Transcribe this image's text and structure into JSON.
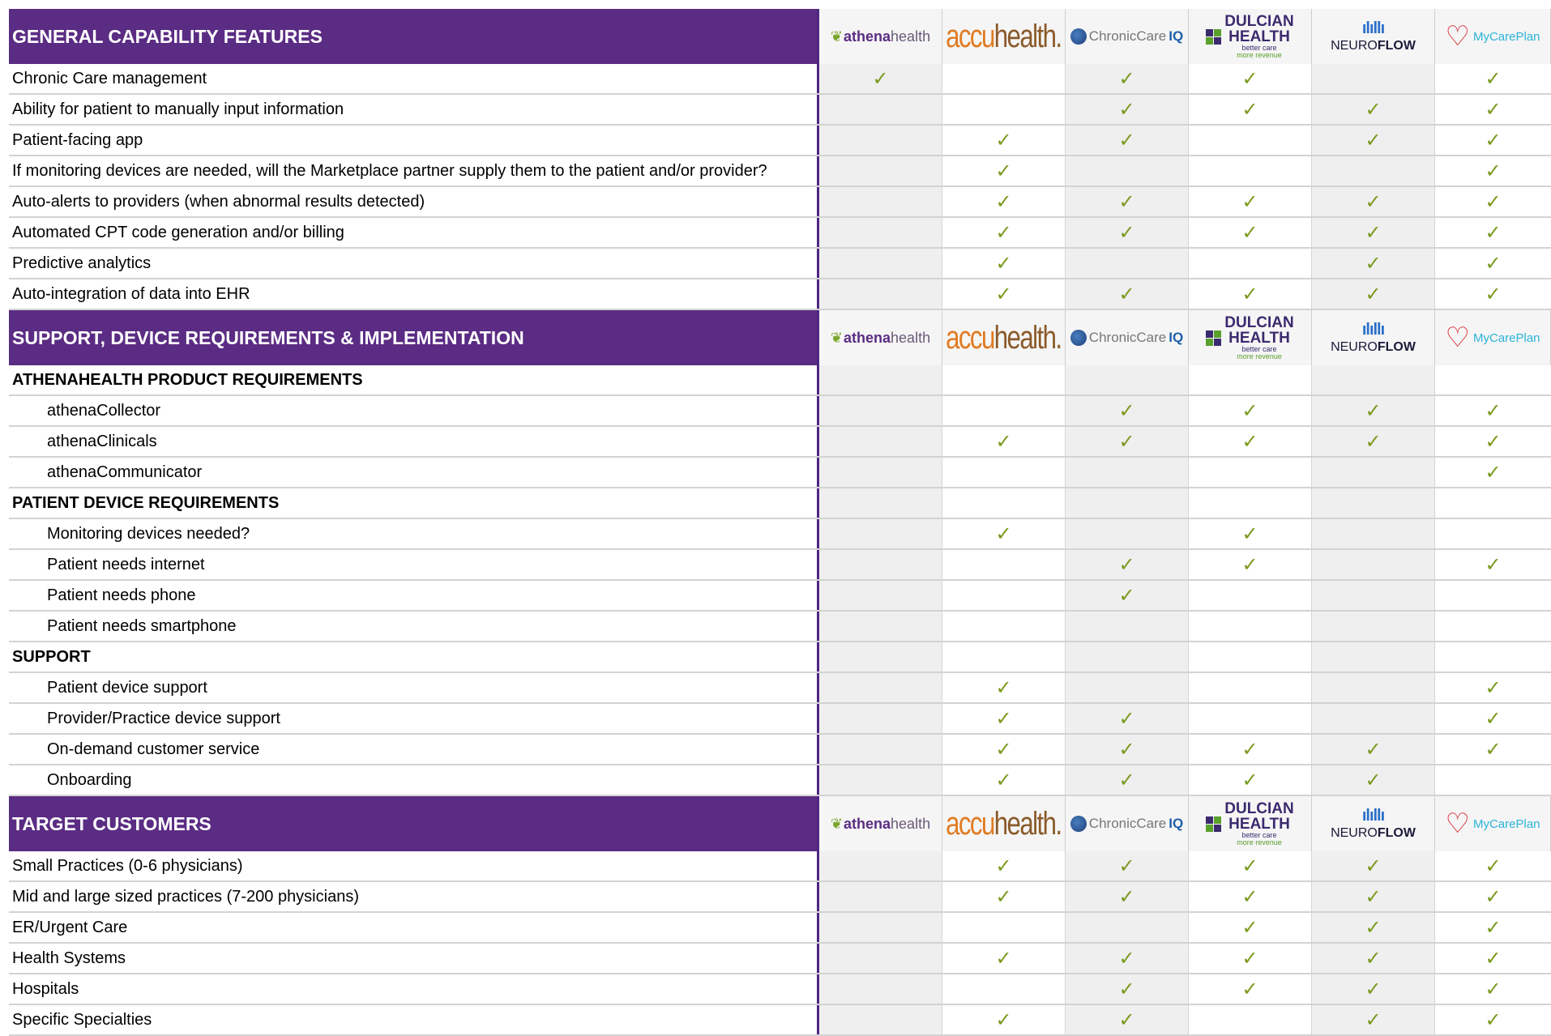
{
  "vendors": [
    {
      "id": "athenahealth",
      "icon": "athenahealth-logo",
      "name_a": "athena",
      "name_b": "health"
    },
    {
      "id": "accuhealth",
      "icon": "accuhealth-logo",
      "name_a": "accu",
      "name_b": "health."
    },
    {
      "id": "chroniccareiq",
      "icon": "chroniccareiq-logo",
      "name_a": "ChronicCare",
      "name_b": "IQ"
    },
    {
      "id": "dulcian",
      "icon": "dulcian-health-logo",
      "name_a": "DULCIAN",
      "name_b": "HEALTH",
      "tag_a": "better care",
      "tag_b": "more revenue"
    },
    {
      "id": "neuroflow",
      "icon": "neuroflow-logo",
      "name_a": "NEURO",
      "name_b": "FLOW"
    },
    {
      "id": "mycareplan",
      "icon": "mycareplan-logo",
      "name_a": "MyCarePlan"
    }
  ],
  "check_glyph": "✓",
  "colors": {
    "header_bg": "#5b2c83",
    "check": "#7a9a1e"
  },
  "sections": [
    {
      "title": "GENERAL CAPABILITY FEATURES",
      "rows": [
        {
          "label": "Chronic Care management",
          "checks": [
            1,
            0,
            1,
            1,
            0,
            1
          ]
        },
        {
          "label": "Ability for patient to manually input information",
          "checks": [
            0,
            0,
            1,
            1,
            1,
            1
          ]
        },
        {
          "label": "Patient-facing app",
          "checks": [
            0,
            1,
            1,
            0,
            1,
            1
          ]
        },
        {
          "label": "If monitoring devices are needed, will the Marketplace partner supply them to the patient and/or provider?",
          "checks": [
            0,
            1,
            0,
            0,
            0,
            1
          ]
        },
        {
          "label": "Auto-alerts to providers (when abnormal results detected)",
          "checks": [
            0,
            1,
            1,
            1,
            1,
            1
          ]
        },
        {
          "label": "Automated CPT code generation and/or billing",
          "checks": [
            0,
            1,
            1,
            1,
            1,
            1
          ]
        },
        {
          "label": "Predictive analytics",
          "checks": [
            0,
            1,
            0,
            0,
            1,
            1
          ]
        },
        {
          "label": "Auto-integration of data into EHR",
          "checks": [
            0,
            1,
            1,
            1,
            1,
            1
          ]
        }
      ]
    },
    {
      "title": "SUPPORT, DEVICE REQUIREMENTS & IMPLEMENTATION",
      "rows": [
        {
          "label": "ATHENAHEALTH PRODUCT REQUIREMENTS",
          "type": "sub",
          "checks": [
            0,
            0,
            0,
            0,
            0,
            0
          ]
        },
        {
          "label": "athenaCollector",
          "type": "indent",
          "checks": [
            0,
            0,
            1,
            1,
            1,
            1
          ]
        },
        {
          "label": "athenaClinicals",
          "type": "indent",
          "checks": [
            0,
            1,
            1,
            1,
            1,
            1
          ]
        },
        {
          "label": "athenaCommunicator",
          "type": "indent",
          "checks": [
            0,
            0,
            0,
            0,
            0,
            1
          ]
        },
        {
          "label": "PATIENT DEVICE REQUIREMENTS",
          "type": "sub",
          "checks": [
            0,
            0,
            0,
            0,
            0,
            0
          ]
        },
        {
          "label": "Monitoring devices needed?",
          "type": "indent",
          "checks": [
            0,
            1,
            0,
            1,
            0,
            0
          ]
        },
        {
          "label": "Patient needs internet",
          "type": "indent",
          "checks": [
            0,
            0,
            1,
            1,
            0,
            1
          ]
        },
        {
          "label": "Patient needs phone",
          "type": "indent",
          "checks": [
            0,
            0,
            1,
            0,
            0,
            0
          ]
        },
        {
          "label": "Patient needs smartphone",
          "type": "indent",
          "checks": [
            0,
            0,
            0,
            0,
            0,
            0
          ]
        },
        {
          "label": "SUPPORT",
          "type": "sub",
          "checks": [
            0,
            0,
            0,
            0,
            0,
            0
          ]
        },
        {
          "label": "Patient device support",
          "type": "indent",
          "checks": [
            0,
            1,
            0,
            0,
            0,
            1
          ]
        },
        {
          "label": "Provider/Practice device support",
          "type": "indent",
          "checks": [
            0,
            1,
            1,
            0,
            0,
            1
          ]
        },
        {
          "label": "On-demand customer service",
          "type": "indent",
          "checks": [
            0,
            1,
            1,
            1,
            1,
            1
          ]
        },
        {
          "label": "Onboarding",
          "type": "indent",
          "checks": [
            0,
            1,
            1,
            1,
            1,
            0
          ]
        }
      ]
    },
    {
      "title": "TARGET CUSTOMERS",
      "rows": [
        {
          "label": "Small Practices (0-6 physicians)",
          "checks": [
            0,
            1,
            1,
            1,
            1,
            1
          ]
        },
        {
          "label": "Mid and large sized practices (7-200 physicians)",
          "checks": [
            0,
            1,
            1,
            1,
            1,
            1
          ]
        },
        {
          "label": "ER/Urgent Care",
          "checks": [
            0,
            0,
            0,
            1,
            1,
            1
          ]
        },
        {
          "label": "Health Systems",
          "checks": [
            0,
            1,
            1,
            1,
            1,
            1
          ]
        },
        {
          "label": "Hospitals",
          "checks": [
            0,
            0,
            1,
            1,
            1,
            1
          ]
        },
        {
          "label": "Specific Specialties",
          "checks": [
            0,
            1,
            1,
            0,
            1,
            1
          ]
        }
      ]
    }
  ]
}
